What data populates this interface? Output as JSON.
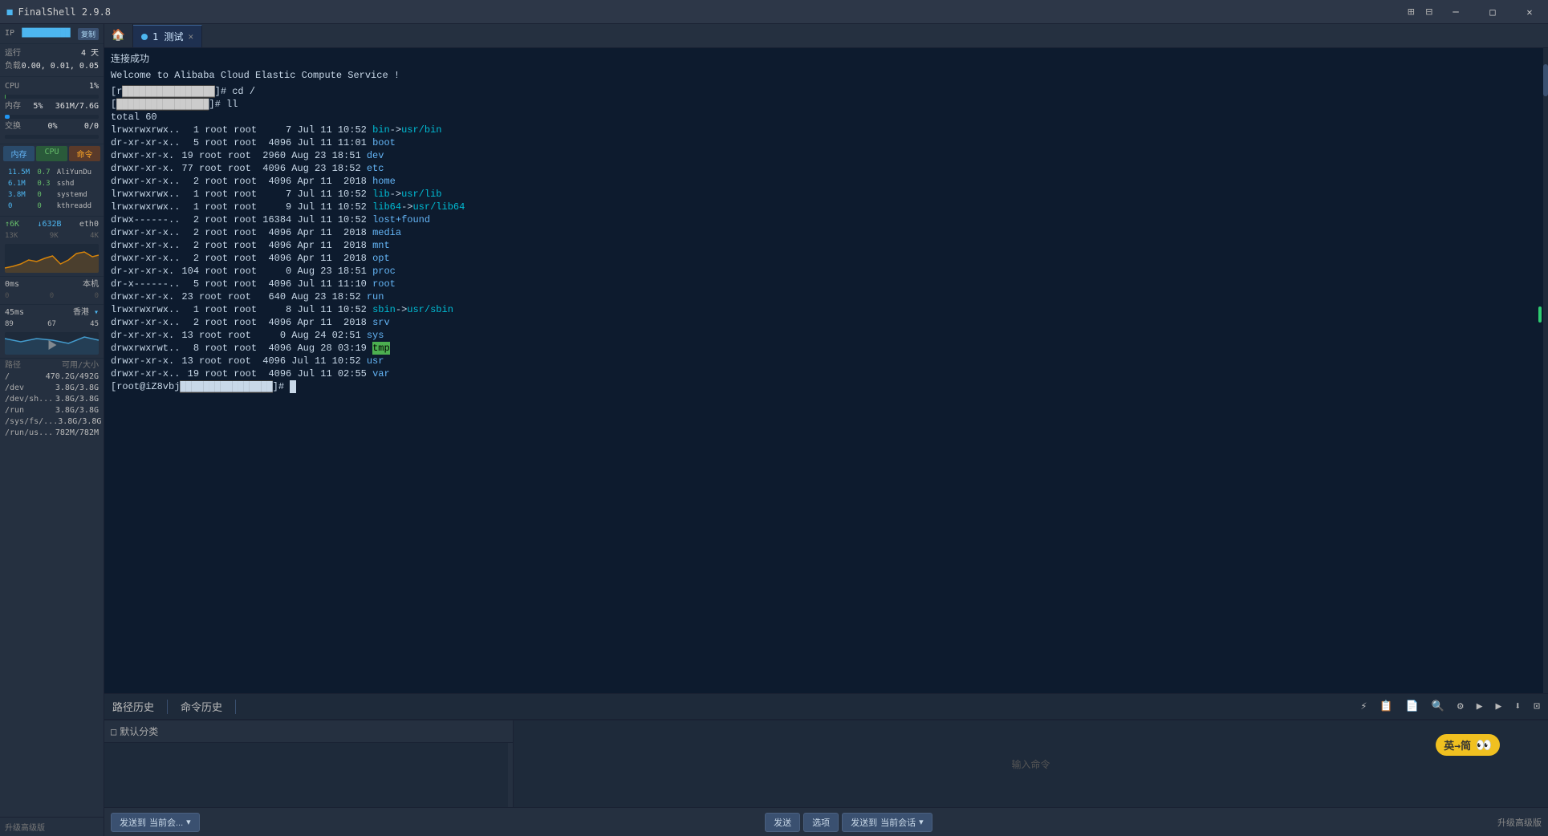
{
  "app": {
    "title": "FinalShell 2.9.8",
    "version": "2.9.8"
  },
  "titlebar": {
    "minimize_label": "─",
    "maximize_label": "□",
    "close_label": "✕",
    "top_icons": [
      "⊞",
      "⊟"
    ]
  },
  "left_panel": {
    "ip_label": "IP",
    "ip_value": "██████████",
    "copy_btn": "复制",
    "uptime_label": "运行",
    "uptime_value": "4 天",
    "load_label": "负载",
    "load_value": "0.00, 0.01, 0.05",
    "cpu_label": "CPU",
    "cpu_value": "1%",
    "cpu_percent": 1,
    "mem_label": "内存",
    "mem_value": "5%",
    "mem_detail": "361M/7.6G",
    "swap_label": "交换",
    "swap_value": "0%",
    "swap_detail": "0/0",
    "tabs": {
      "mem": "内存",
      "cpu": "CPU",
      "cmd": "命令"
    },
    "processes": [
      {
        "mem": "11.5M",
        "cpu": "0.7",
        "name": "AliYunDu"
      },
      {
        "mem": "6.1M",
        "cpu": "0.3",
        "name": "sshd"
      },
      {
        "mem": "3.8M",
        "cpu": "0",
        "name": "systemd"
      },
      {
        "mem": "0",
        "cpu": "0",
        "name": "kthreadd"
      }
    ],
    "network": {
      "interface": "eth0",
      "up_label": "↑6K",
      "down_label": "↓632B",
      "values": [
        "13K",
        "9K",
        "4K"
      ]
    },
    "latency_label": "本机",
    "latency_ms_label": "0ms",
    "latency_values": [
      0,
      0,
      0
    ],
    "server_label": "香港",
    "server_ms": "45ms",
    "server_vals": [
      89,
      67,
      45
    ],
    "disks_header_label": "路径",
    "disks_header_size": "可用/大小",
    "disks": [
      {
        "path": "/",
        "size": "470.2G/492G"
      },
      {
        "path": "/dev",
        "size": "3.8G/3.8G"
      },
      {
        "path": "/dev/sh...",
        "size": "3.8G/3.8G"
      },
      {
        "path": "/run",
        "size": "3.8G/3.8G"
      },
      {
        "path": "/sys/fs/...",
        "size": "3.8G/3.8G"
      },
      {
        "path": "/run/us...",
        "size": "782M/782M"
      }
    ],
    "upgrade_label": "升级高级版"
  },
  "tabs": {
    "home_icon": "🏠",
    "active_tab": "1 测试"
  },
  "terminal": {
    "connected_msg": "连接成功",
    "welcome_msg": "Welcome to Alibaba Cloud Elastic Compute Service !",
    "commands": [
      {
        "prompt": "[r████████████████]# cd /"
      },
      {
        "prompt": "[████████████████]# ll"
      }
    ],
    "total_line": "total 60",
    "files": [
      {
        "perms": "lrwxrwxrwx.",
        "links": "1",
        "owner": "root",
        "group": "root",
        "size": "7",
        "date": "Jul 11 10:52",
        "name": "bin",
        "arrow": "->",
        "target": "usr/bin",
        "color": "cyan"
      },
      {
        "perms": "dr-xr-xr-x.",
        "links": "5",
        "owner": "root",
        "group": "root",
        "size": "4096",
        "date": "Jul 11 11:01",
        "name": "boot",
        "arrow": "",
        "target": "",
        "color": "blue"
      },
      {
        "perms": "drwxr-xr-x",
        "links": "19",
        "owner": "root",
        "group": "root",
        "size": "2960",
        "date": "Aug 23 18:51",
        "name": "dev",
        "arrow": "",
        "target": "",
        "color": "blue"
      },
      {
        "perms": "drwxr-xr-x",
        "links": "77",
        "owner": "root",
        "group": "root",
        "size": "4096",
        "date": "Aug 23 18:52",
        "name": "etc",
        "arrow": "",
        "target": "",
        "color": "blue"
      },
      {
        "perms": "drwxr-xr-x.",
        "links": "2",
        "owner": "root",
        "group": "root",
        "size": "4096",
        "date": "Apr 11  2018",
        "name": "home",
        "arrow": "",
        "target": "",
        "color": "blue"
      },
      {
        "perms": "lrwxrwxrwx.",
        "links": "1",
        "owner": "root",
        "group": "root",
        "size": "7",
        "date": "Jul 11 10:52",
        "name": "lib",
        "arrow": "->",
        "target": "usr/lib",
        "color": "cyan"
      },
      {
        "perms": "lrwxrwxrwx.",
        "links": "1",
        "owner": "root",
        "group": "root",
        "size": "9",
        "date": "Jul 11 10:52",
        "name": "lib64",
        "arrow": "->",
        "target": "usr/lib64",
        "color": "cyan"
      },
      {
        "perms": "drwx------.",
        "links": "2",
        "owner": "root",
        "group": "root",
        "size": "16384",
        "date": "Jul 11 10:52",
        "name": "lost+found",
        "arrow": "",
        "target": "",
        "color": "blue"
      },
      {
        "perms": "drwxr-xr-x.",
        "links": "2",
        "owner": "root",
        "group": "root",
        "size": "4096",
        "date": "Apr 11  2018",
        "name": "media",
        "arrow": "",
        "target": "",
        "color": "blue"
      },
      {
        "perms": "drwxr-xr-x.",
        "links": "2",
        "owner": "root",
        "group": "root",
        "size": "4096",
        "date": "Apr 11  2018",
        "name": "mnt",
        "arrow": "",
        "target": "",
        "color": "blue"
      },
      {
        "perms": "drwxr-xr-x.",
        "links": "2",
        "owner": "root",
        "group": "root",
        "size": "4096",
        "date": "Apr 11  2018",
        "name": "opt",
        "arrow": "",
        "target": "",
        "color": "blue"
      },
      {
        "perms": "dr-xr-xr-x",
        "links": "104",
        "owner": "root",
        "group": "root",
        "size": "0",
        "date": "Aug 23 18:51",
        "name": "proc",
        "arrow": "",
        "target": "",
        "color": "blue"
      },
      {
        "perms": "dr-x------.",
        "links": "5",
        "owner": "root",
        "group": "root",
        "size": "4096",
        "date": "Jul 11 11:10",
        "name": "root",
        "arrow": "",
        "target": "",
        "color": "blue"
      },
      {
        "perms": "drwxr-xr-x",
        "links": "23",
        "owner": "root",
        "group": "root",
        "size": "640",
        "date": "Aug 23 18:52",
        "name": "run",
        "arrow": "",
        "target": "",
        "color": "blue"
      },
      {
        "perms": "lrwxrwxrwx.",
        "links": "1",
        "owner": "root",
        "group": "root",
        "size": "8",
        "date": "Jul 11 10:52",
        "name": "sbin",
        "arrow": "->",
        "target": "usr/sbin",
        "color": "cyan"
      },
      {
        "perms": "drwxr-xr-x.",
        "links": "2",
        "owner": "root",
        "group": "root",
        "size": "4096",
        "date": "Apr 11  2018",
        "name": "srv",
        "arrow": "",
        "target": "",
        "color": "blue"
      },
      {
        "perms": "dr-xr-xr-x",
        "links": "13",
        "owner": "root",
        "group": "root",
        "size": "0",
        "date": "Aug 24 02:51",
        "name": "sys",
        "arrow": "",
        "target": "",
        "color": "blue"
      },
      {
        "perms": "drwxrwxrwt.",
        "links": "8",
        "owner": "root",
        "group": "root",
        "size": "4096",
        "date": "Aug 28 03:19",
        "name": "tmp",
        "arrow": "",
        "target": "",
        "color": "highlight-green"
      },
      {
        "perms": "drwxr-xr-x",
        "links": "13",
        "owner": "root",
        "group": "root",
        "size": "4096",
        "date": "Jul 11 10:52",
        "name": "usr",
        "arrow": "",
        "target": "",
        "color": "blue"
      },
      {
        "perms": "drwxr-xr-x.",
        "links": "19",
        "owner": "root",
        "group": "root",
        "size": "4096",
        "date": "Jul 11 02:55",
        "name": "var",
        "arrow": "",
        "target": "",
        "color": "blue"
      }
    ],
    "last_prompt": "[root@iZ8vbj████████████]#"
  },
  "bottom_toolbar": {
    "path_history": "路径历史",
    "cmd_history": "命令历史",
    "icons": [
      "⚡",
      "📋",
      "📄",
      "🔍",
      "⚙",
      "▶",
      "▶",
      "⬇",
      "⊡"
    ]
  },
  "cmd_area": {
    "category_icon": "□",
    "category_label": "默认分类",
    "placeholder": "",
    "hint_label": "输入命令",
    "send_btn": "发送",
    "options_btn": "选项",
    "send_to_btn": "发送到",
    "session_btn": "当前会话"
  },
  "bottom_action_bar": {
    "send_to_label": "发送到",
    "current_session_label": "当前会...",
    "send_label": "发送",
    "options_label": "选项",
    "send_to2_label": "发送到",
    "current_session2_label": "当前会话",
    "upgrade_label": "升级高级版"
  },
  "trans_badge": {
    "label": "英→简",
    "eyes": "👀"
  },
  "colors": {
    "terminal_bg": "#0d1b2e",
    "panel_bg": "#253040",
    "accent": "#4db6f0"
  }
}
